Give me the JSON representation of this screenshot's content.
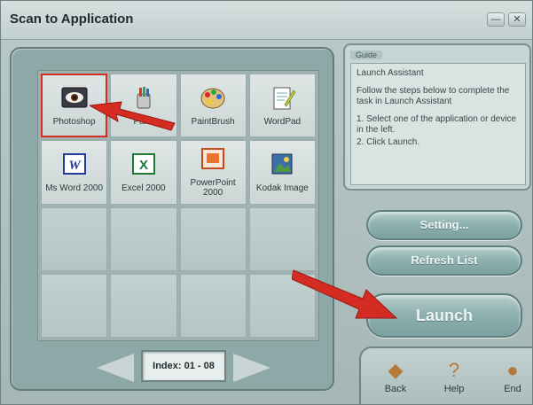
{
  "window": {
    "title": "Scan to Application"
  },
  "controls": {
    "minimize": "—",
    "close": "✕"
  },
  "apps": [
    {
      "label": "Photoshop",
      "icon": "photoshop-eye-icon",
      "selected": true
    },
    {
      "label": "Paint",
      "icon": "paint-bucket-icon",
      "selected": false
    },
    {
      "label": "PaintBrush",
      "icon": "palette-icon",
      "selected": false
    },
    {
      "label": "WordPad",
      "icon": "wordpad-icon",
      "selected": false
    },
    {
      "label": "Ms Word 2000",
      "icon": "word-icon",
      "selected": false
    },
    {
      "label": "Excel 2000",
      "icon": "excel-icon",
      "selected": false
    },
    {
      "label": "PowerPoint 2000",
      "icon": "powerpoint-icon",
      "selected": false
    },
    {
      "label": "Kodak Image",
      "icon": "kodak-image-icon",
      "selected": false
    }
  ],
  "index": {
    "label": "Index: 01 - 08"
  },
  "guide": {
    "title": "Guide",
    "heading": "Launch Assistant",
    "text1": "Follow the steps below to complete the task in Launch Assistant",
    "step1": "1. Select one of the application or device in the left.",
    "step2": "2. Click Launch."
  },
  "buttons": {
    "setting": "Setting...",
    "refresh": "Refresh List",
    "launch": "Launch"
  },
  "bottom": {
    "back": "Back",
    "help": "Help",
    "end": "End"
  },
  "colors": {
    "accent_red": "#d52d22",
    "panel": "#8ca9a8",
    "button": "#8fb1b0"
  }
}
